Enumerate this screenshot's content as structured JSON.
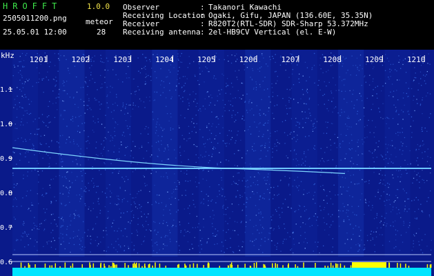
{
  "header": {
    "app_title": "HROFFT",
    "app_version": "1.0.0",
    "file_name": "2505011200.png",
    "timestamp": "25.05.01 12:00",
    "meteor_label": "meteor",
    "meteor_count": "28"
  },
  "station_info": [
    {
      "label": "Observer",
      "value": "Takanori Kawachi"
    },
    {
      "label": "Receiving Location",
      "value": "Ogaki, Gifu, JAPAN (136.60E, 35.35N)"
    },
    {
      "label": "Receiver",
      "value": "R820T2(RTL-SDR) SDR-Sharp 53.372MHz"
    },
    {
      "label": "Receiving antenna",
      "value": "2el-HB9CV Vertical (el. E-W)"
    }
  ],
  "spectrogram": {
    "y_unit": "kHz",
    "time_ticks": [
      "1201",
      "1202",
      "1203",
      "1204",
      "1205",
      "1206",
      "1207",
      "1208",
      "1209",
      "1210"
    ],
    "freq_ticks": [
      "1.1",
      "1.0",
      "0.9",
      "0.8",
      "0.7",
      "0.6"
    ],
    "freq_range_khz": [
      0.6,
      1.15
    ],
    "carrier_khz": 0.87,
    "colors": {
      "background": "#0a1a8a",
      "noise": "#3a70e0",
      "trace": "#9ff0ff",
      "level_bar": "#00e5ff",
      "level_peak": "#ffff00",
      "tick_text": "#ffffff"
    }
  }
}
